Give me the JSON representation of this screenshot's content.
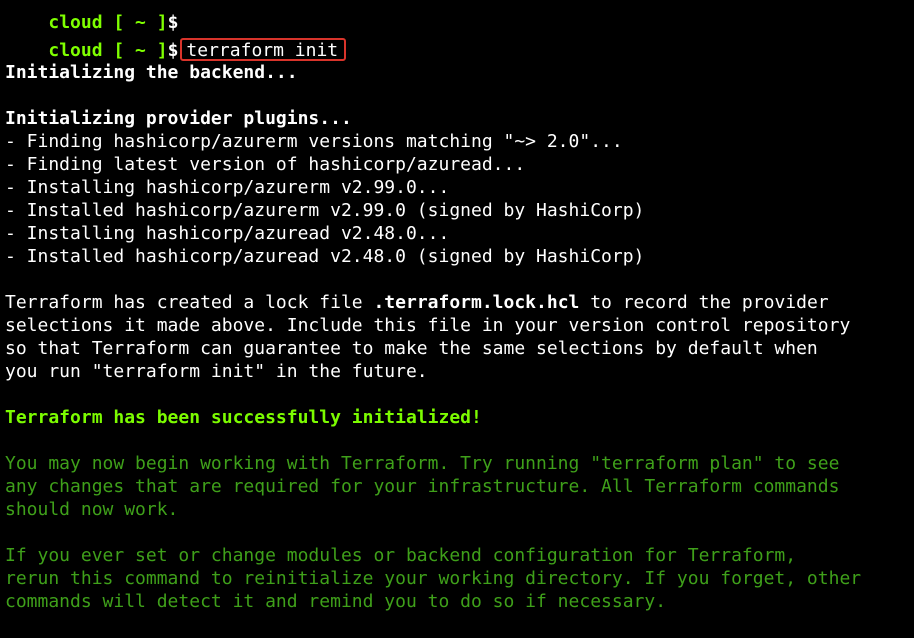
{
  "terminal": {
    "colors": {
      "background": "#000000",
      "prompt": "#7fff00",
      "text": "#ffffff",
      "success": "#7cfc00",
      "info": "#3fa01a",
      "highlight_border": "#d9342b"
    },
    "prompt_host": "cloud [ ~ ]",
    "prompt_symbol": "$",
    "command": "terraform init",
    "backend_init": "Initializing the backend...",
    "provider_init": "Initializing provider plugins...",
    "provider_steps": [
      "- Finding hashicorp/azurerm versions matching \"~> 2.0\"...",
      "- Finding latest version of hashicorp/azuread...",
      "- Installing hashicorp/azurerm v2.99.0...",
      "- Installed hashicorp/azurerm v2.99.0 (signed by HashiCorp)",
      "- Installing hashicorp/azuread v2.48.0...",
      "- Installed hashicorp/azuread v2.48.0 (signed by HashiCorp)"
    ],
    "lock_text": {
      "before": "Terraform has created a lock file ",
      "file": ".terraform.lock.hcl",
      "after": " to record the provider",
      "line2": "selections it made above. Include this file in your version control repository",
      "line3": "so that Terraform can guarantee to make the same selections by default when",
      "line4": "you run \"terraform init\" in the future."
    },
    "success_message": "Terraform has been successfully initialized!",
    "next_steps": [
      "You may now begin working with Terraform. Try running \"terraform plan\" to see",
      "any changes that are required for your infrastructure. All Terraform commands",
      "should now work."
    ],
    "reinit_note": [
      "If you ever set or change modules or backend configuration for Terraform,",
      "rerun this command to reinitialize your working directory. If you forget, other",
      "commands will detect it and remind you to do so if necessary."
    ]
  }
}
